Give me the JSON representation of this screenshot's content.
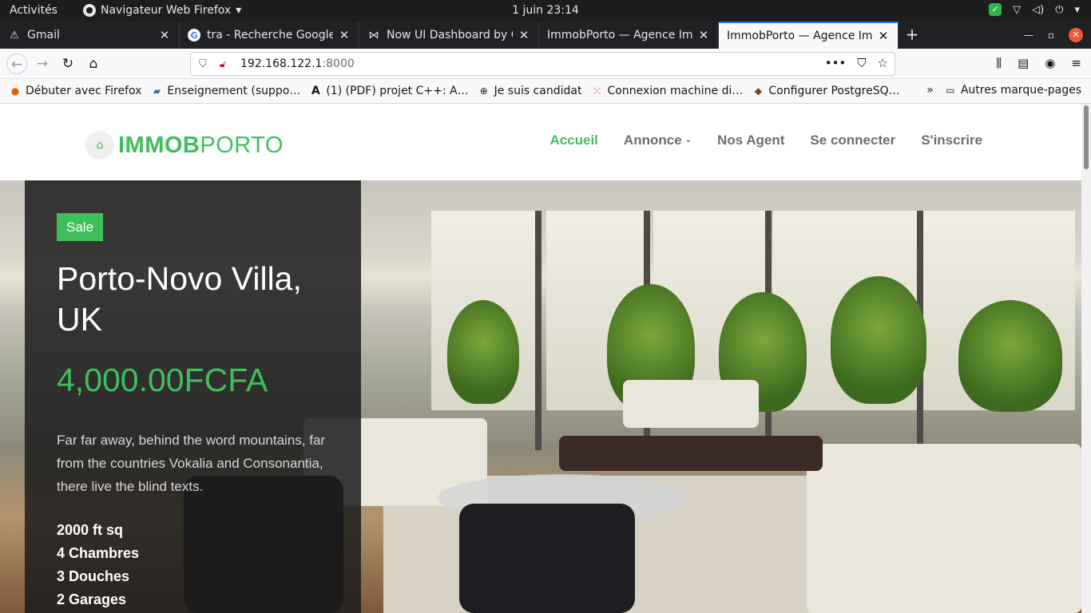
{
  "topbar": {
    "activities": "Activités",
    "app_name": "Navigateur Web Firefox",
    "app_caret": "▾",
    "clock": "1 juin  23:14"
  },
  "tabs": [
    {
      "title": "Gmail",
      "icon": "warning-icon"
    },
    {
      "title": "tra - Recherche Google",
      "icon": "google-icon"
    },
    {
      "title": "Now UI Dashboard by Cr",
      "icon": "bowtie-icon"
    },
    {
      "title": "ImmobPorto — Agence Imm",
      "icon": "none"
    },
    {
      "title": "ImmobPorto — Agence Imm",
      "icon": "none",
      "active": true
    }
  ],
  "urlbar": {
    "host": "192.168.122.1",
    "port": ":8000"
  },
  "bookmarks": [
    {
      "label": "Débuter avec Firefox",
      "icon": "firefox-icon"
    },
    {
      "label": "Enseignement (suppo…",
      "icon": "book-icon"
    },
    {
      "label": "(1) (PDF) projet C++: A…",
      "icon": "academia-icon"
    },
    {
      "label": "Je suis candidat",
      "icon": "globe-icon"
    },
    {
      "label": "Connexion machine di…",
      "icon": "git-icon"
    },
    {
      "label": "Configurer PostgreSQ…",
      "icon": "elephant-icon"
    }
  ],
  "bookmarks_more": "Autres marque-pages",
  "site": {
    "logo_bold": "IMMOB",
    "logo_light": "PORTO",
    "nav": [
      {
        "label": "Accueil",
        "active": true
      },
      {
        "label": "Annonce",
        "dropdown": true
      },
      {
        "label": "Nos Agent"
      },
      {
        "label": "Se connecter"
      },
      {
        "label": "S'inscrire"
      }
    ]
  },
  "hero": {
    "badge": "Sale",
    "title": "Porto-Novo Villa, UK",
    "price": "4,000.00FCFA",
    "description": "Far far away, behind the word mountains, far from the countries Vokalia and Consonantia, there live the blind texts.",
    "specs": [
      "2000 ft sq",
      "4 Chambres",
      "3 Douches",
      "2 Garages"
    ]
  },
  "colors": {
    "brand_green": "#3fbf5b",
    "overlay": "#1c1c1c"
  }
}
